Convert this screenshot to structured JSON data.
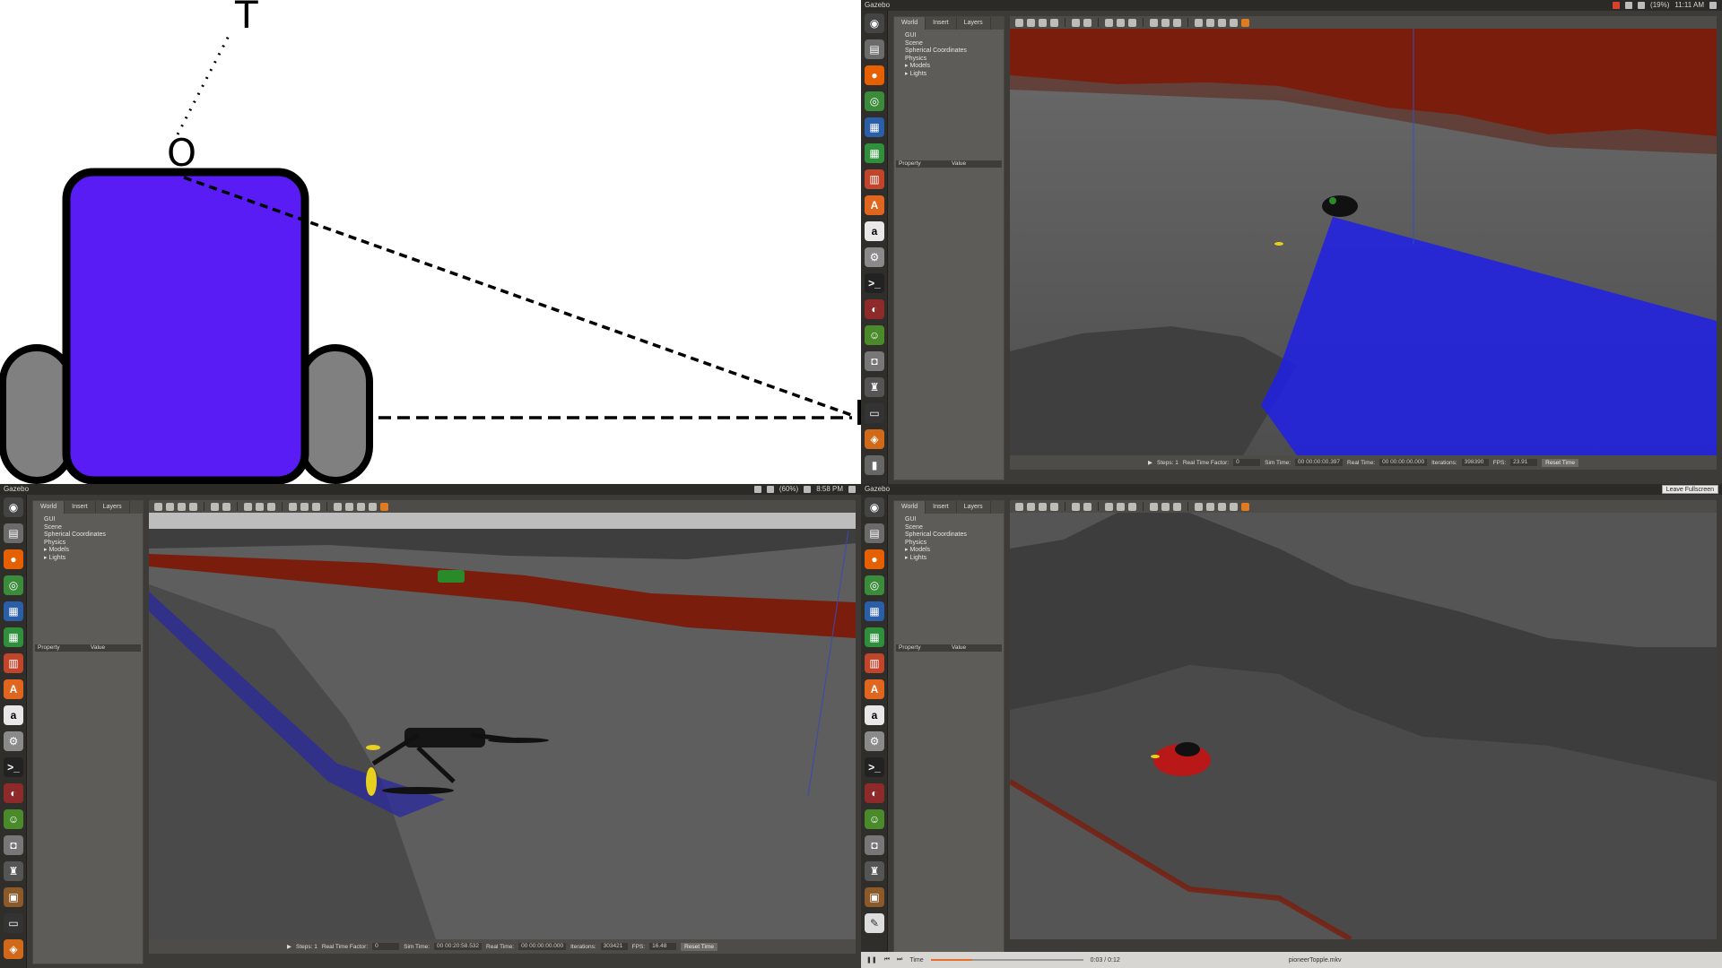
{
  "diagram": {
    "label_top": "T",
    "label_mid": "O"
  },
  "gazebo": {
    "app_title": "Gazebo",
    "tabs": [
      "World",
      "Insert",
      "Layers"
    ],
    "tree": [
      "GUI",
      "Scene",
      "Spherical Coordinates",
      "Physics",
      "Models",
      "Lights"
    ],
    "property_header": {
      "property": "Property",
      "value": "Value"
    },
    "status_labels": {
      "steps": "Steps: 1",
      "real_time_factor": "Real Time Factor:",
      "sim_time": "Sim Time:",
      "real_time": "Real Time:",
      "iterations": "Iterations:",
      "fps": "FPS:",
      "reset": "Reset Time"
    }
  },
  "panels": {
    "top_right": {
      "clock": "11:11 AM",
      "battery": "(19%)",
      "rtf": "0",
      "sim_time": "00 00:00:00.397",
      "real_time": "00 00:00:00.000",
      "iterations": "398390",
      "fps": "23.91"
    },
    "bottom_left": {
      "clock": "8:58 PM",
      "battery": "(60%)",
      "rtf": "0",
      "sim_time": "00 00:20:58.532",
      "real_time": "00 00:00:00.000",
      "iterations": "303421",
      "fps": "16.48"
    },
    "bottom_right": {
      "clock": "",
      "fullscreen_button": "Leave Fullscreen",
      "media_time_label": "Time",
      "media_time": "0:03 / 0:12",
      "media_progress": 0.27,
      "media_file": "pioneerTopple.mkv"
    }
  },
  "colors": {
    "robot_body": "#5a1cf4",
    "wheels": "#808080",
    "laser": "#1c1cf0",
    "hazard": "#8a1a0a",
    "ground": "#5b5b5b"
  }
}
